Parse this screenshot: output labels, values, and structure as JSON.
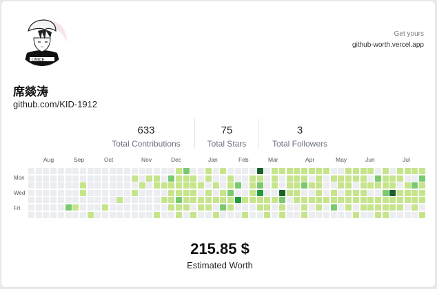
{
  "profile": {
    "name": "席燚涛",
    "handle": "github.com/KID-1912",
    "avatar_icon": "anime-avatar"
  },
  "promo": {
    "line1": "Get yours",
    "line2": "github-worth.vercel.app"
  },
  "stats": [
    {
      "value": "633",
      "label": "Total Contributions"
    },
    {
      "value": "75",
      "label": "Total Stars"
    },
    {
      "value": "3",
      "label": "Total Followers"
    }
  ],
  "calendar": {
    "months": [
      "Aug",
      "Sep",
      "Oct",
      "Nov",
      "Dec",
      "Jan",
      "Feb",
      "Mar",
      "Apr",
      "May",
      "Jun",
      "Jul"
    ],
    "days": [
      "Mon",
      "Wed",
      "Fri"
    ],
    "colors": [
      "#ebedf0",
      "#c6e48b",
      "#7bc96f",
      "#239a3b",
      "#196127"
    ],
    "weeks": [
      [
        0,
        0,
        0,
        0,
        0,
        0,
        0
      ],
      [
        0,
        0,
        0,
        0,
        0,
        0,
        0
      ],
      [
        0,
        0,
        0,
        0,
        0,
        0,
        0
      ],
      [
        0,
        0,
        0,
        0,
        0,
        0,
        0
      ],
      [
        0,
        0,
        0,
        0,
        0,
        0,
        0
      ],
      [
        0,
        0,
        0,
        0,
        0,
        2,
        0
      ],
      [
        0,
        0,
        0,
        0,
        0,
        1,
        0
      ],
      [
        0,
        0,
        1,
        1,
        0,
        0,
        0
      ],
      [
        0,
        0,
        0,
        0,
        0,
        0,
        1
      ],
      [
        0,
        0,
        0,
        0,
        0,
        0,
        0
      ],
      [
        0,
        0,
        0,
        0,
        0,
        1,
        0
      ],
      [
        0,
        0,
        0,
        0,
        0,
        0,
        0
      ],
      [
        0,
        0,
        0,
        0,
        1,
        0,
        0
      ],
      [
        0,
        0,
        0,
        0,
        0,
        0,
        0
      ],
      [
        0,
        1,
        0,
        1,
        0,
        0,
        0
      ],
      [
        0,
        0,
        1,
        0,
        0,
        0,
        0
      ],
      [
        0,
        1,
        0,
        0,
        0,
        0,
        0
      ],
      [
        0,
        1,
        1,
        0,
        0,
        0,
        1
      ],
      [
        0,
        0,
        1,
        0,
        1,
        0,
        0
      ],
      [
        0,
        2,
        1,
        1,
        1,
        1,
        0
      ],
      [
        1,
        1,
        1,
        1,
        2,
        1,
        1
      ],
      [
        2,
        1,
        1,
        1,
        1,
        1,
        0
      ],
      [
        0,
        1,
        1,
        1,
        1,
        0,
        1
      ],
      [
        0,
        0,
        1,
        0,
        1,
        1,
        0
      ],
      [
        1,
        1,
        0,
        1,
        1,
        1,
        0
      ],
      [
        0,
        0,
        1,
        0,
        1,
        0,
        1
      ],
      [
        1,
        0,
        0,
        1,
        1,
        2,
        0
      ],
      [
        0,
        1,
        1,
        2,
        1,
        1,
        0
      ],
      [
        0,
        0,
        2,
        0,
        3,
        0,
        0
      ],
      [
        0,
        0,
        0,
        0,
        1,
        0,
        1
      ],
      [
        0,
        1,
        1,
        1,
        1,
        0,
        0
      ],
      [
        4,
        1,
        2,
        3,
        1,
        1,
        0
      ],
      [
        0,
        0,
        0,
        0,
        1,
        1,
        1
      ],
      [
        1,
        1,
        1,
        0,
        1,
        0,
        0
      ],
      [
        1,
        0,
        0,
        4,
        2,
        1,
        1
      ],
      [
        1,
        1,
        1,
        1,
        0,
        0,
        0
      ],
      [
        1,
        1,
        1,
        1,
        1,
        0,
        0
      ],
      [
        1,
        1,
        2,
        0,
        1,
        1,
        1
      ],
      [
        1,
        0,
        1,
        0,
        1,
        0,
        0
      ],
      [
        1,
        1,
        1,
        1,
        1,
        1,
        0
      ],
      [
        1,
        0,
        0,
        0,
        1,
        0,
        0
      ],
      [
        0,
        1,
        0,
        1,
        1,
        2,
        0
      ],
      [
        0,
        1,
        1,
        0,
        1,
        0,
        0
      ],
      [
        1,
        1,
        1,
        1,
        1,
        1,
        0
      ],
      [
        1,
        1,
        0,
        1,
        1,
        0,
        1
      ],
      [
        1,
        1,
        1,
        1,
        1,
        1,
        0
      ],
      [
        1,
        0,
        1,
        0,
        1,
        1,
        0
      ],
      [
        0,
        2,
        1,
        0,
        1,
        1,
        1
      ],
      [
        1,
        1,
        1,
        2,
        1,
        1,
        1
      ],
      [
        0,
        1,
        1,
        4,
        1,
        1,
        0
      ],
      [
        1,
        1,
        0,
        1,
        1,
        1,
        0
      ],
      [
        1,
        0,
        1,
        1,
        1,
        0,
        0
      ],
      [
        1,
        0,
        2,
        1,
        1,
        1,
        0
      ],
      [
        1,
        2,
        1,
        1,
        1,
        0,
        1
      ]
    ]
  },
  "worth": {
    "amount": "215.85 $",
    "label": "Estimated Worth"
  }
}
